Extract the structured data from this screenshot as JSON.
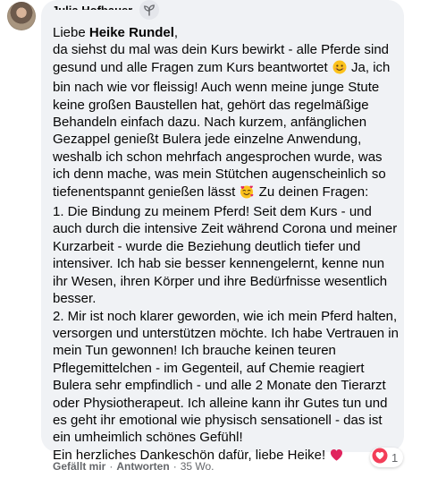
{
  "comment": {
    "author": "Julia Hofbauer",
    "greeting_prefix": "Liebe ",
    "mention": "Heike Rundel",
    "greeting_suffix": ",",
    "paragraph1_a": "da siehst du mal was dein Kurs bewirkt - alle Pferde sind gesund und alle Fragen zum Kurs beantwortet",
    "paragraph1_b": " Ja, ich bin nach wie vor fleissig! Auch wenn meine junge Stute keine großen Baustellen hat, gehört das regelmäßige Behandeln einfach dazu. Nach kurzem, anfänglichen Gezappel genießt Bulera jede einzelne Anwendung, weshalb ich schon mehrfach angesprochen wurde, was ich denn mache, was mein Stütchen augenscheinlich so tiefenentspannt genießen lässt",
    "paragraph1_c": " Zu deinen Fragen:",
    "point1": "1. Die Bindung zu meinem Pferd! Seit dem Kurs - und auch durch die intensive Zeit während Corona und meiner Kurzarbeit - wurde die Beziehung deutlich tiefer und intensiver. Ich hab sie besser kennengelernt, kenne nun ihr Wesen, ihren Körper und ihre Bedürfnisse wesentlich besser.",
    "point2": "2. Mir ist noch klarer geworden, wie ich mein Pferd halten, versorgen und unterstützen möchte. Ich habe Vertrauen in mein Tun gewonnen! Ich brauche keinen teuren Pflegemittelchen - im Gegenteil, auf Chemie reagiert Bulera sehr empfindlich - und alle 2 Monate den Tierarzt oder Physiotherapeut. Ich alleine kann ihr Gutes tun und es geht ihr emotional wie physisch sensationell - das ist ein umheimlich schönes Gefühl!",
    "closing": "Ein herzliches Dankeschön dafür, liebe Heike!",
    "emoji_1": "smiling-face-icon",
    "emoji_2": "smiling-face-with-hearts-icon",
    "emoji_3": "red-heart-icon",
    "badge_icon": "seedling-icon"
  },
  "actions": {
    "like": "Gefällt mir",
    "separator": "·",
    "reply": "Antworten",
    "time": "35 Wo."
  },
  "reaction": {
    "icon": "love-reaction-icon",
    "count": "1",
    "color": "#f33e58"
  },
  "colors": {
    "bubble": "#f0f2f5",
    "text": "#050505",
    "secondary": "#65676b"
  }
}
